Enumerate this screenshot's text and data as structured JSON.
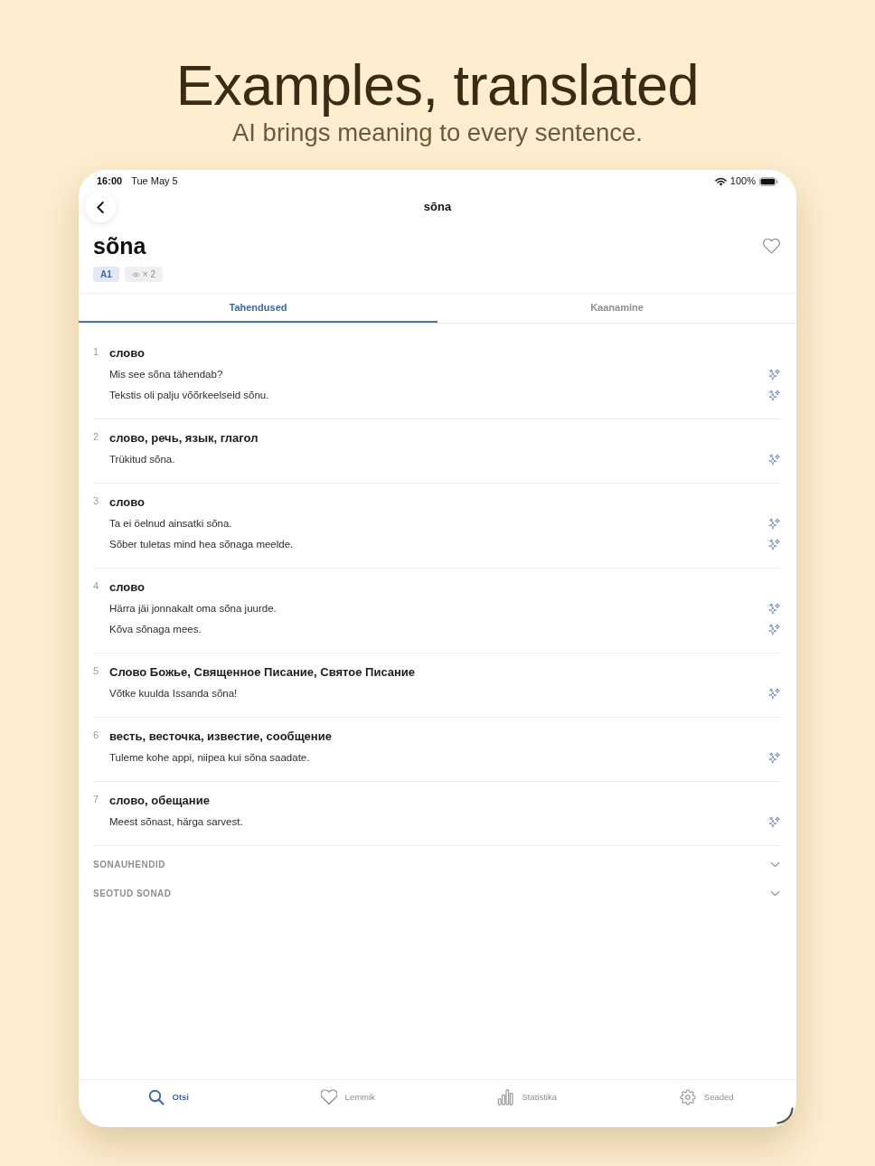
{
  "header": {
    "title": "Examples, translated",
    "subtitle": "AI brings meaning to every sentence."
  },
  "status_bar": {
    "time": "16:00",
    "date": "Tue May 5",
    "battery": "100%"
  },
  "nav": {
    "title": "sõna"
  },
  "word": {
    "text": "sõna",
    "favorite": false,
    "level": "A1",
    "views": "× 2"
  },
  "tabs": [
    {
      "label": "Tahendused",
      "selected": true
    },
    {
      "label": "Kaanamine",
      "selected": false
    }
  ],
  "meanings": [
    {
      "number": "1",
      "translation": "слово",
      "examples": [
        "Mis see sõna tähendab?",
        "Tekstis oli palju võõrkeelseid sõnu."
      ]
    },
    {
      "number": "2",
      "translation": "слово, речь, язык, глагол",
      "examples": [
        "Trükitud sõna."
      ]
    },
    {
      "number": "3",
      "translation": "слово",
      "examples": [
        "Ta ei öelnud ainsatki sõna.",
        "Sõber tuletas mind hea sõnaga meelde."
      ]
    },
    {
      "number": "4",
      "translation": "слово",
      "examples": [
        "Härra jäi jonnakalt oma sõna juurde.",
        "Kõva sõnaga mees."
      ]
    },
    {
      "number": "5",
      "translation": "Слово Божье, Священное Писание, Святое Писание",
      "examples": [
        "Võtke kuulda Issanda sõna!"
      ]
    },
    {
      "number": "6",
      "translation": "весть, весточка, известие, сообщение",
      "examples": [
        "Tuleme kohe appi, niipea kui sõna saadate."
      ]
    },
    {
      "number": "7",
      "translation": "слово, обещание",
      "examples": [
        "Meest sõnast, härga sarvest."
      ]
    }
  ],
  "sections": [
    {
      "label": "SONAUHENDID",
      "expanded": false
    },
    {
      "label": "SEOTUD SONAD",
      "expanded": false
    }
  ],
  "tab_bar": [
    {
      "kind": "search",
      "label": "Otsi",
      "selected": true
    },
    {
      "kind": "heart",
      "label": "Lemmik",
      "selected": false
    },
    {
      "kind": "chart",
      "label": "Statistika",
      "selected": false
    },
    {
      "kind": "gear",
      "label": "Seaded",
      "selected": false
    }
  ]
}
